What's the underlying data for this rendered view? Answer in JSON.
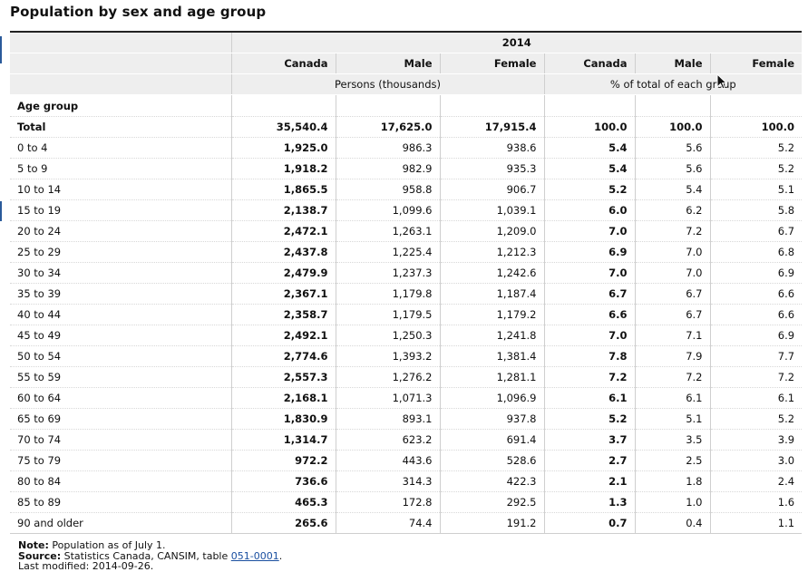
{
  "page": {
    "title": "Population by sex and age group"
  },
  "table": {
    "year": "2014",
    "columns": [
      "Canada",
      "Male",
      "Female",
      "Canada",
      "Male",
      "Female"
    ],
    "unit_groups": [
      "Persons (thousands)",
      "% of total of each group"
    ],
    "row_header_label": "Age group",
    "rows": [
      {
        "label": "Total",
        "values": [
          "35,540.4",
          "17,625.0",
          "17,915.4",
          "100.0",
          "100.0",
          "100.0"
        ]
      },
      {
        "label": "0 to 4",
        "values": [
          "1,925.0",
          "986.3",
          "938.6",
          "5.4",
          "5.6",
          "5.2"
        ]
      },
      {
        "label": "5 to 9",
        "values": [
          "1,918.2",
          "982.9",
          "935.3",
          "5.4",
          "5.6",
          "5.2"
        ]
      },
      {
        "label": "10 to 14",
        "values": [
          "1,865.5",
          "958.8",
          "906.7",
          "5.2",
          "5.4",
          "5.1"
        ]
      },
      {
        "label": "15 to 19",
        "values": [
          "2,138.7",
          "1,099.6",
          "1,039.1",
          "6.0",
          "6.2",
          "5.8"
        ]
      },
      {
        "label": "20 to 24",
        "values": [
          "2,472.1",
          "1,263.1",
          "1,209.0",
          "7.0",
          "7.2",
          "6.7"
        ]
      },
      {
        "label": "25 to 29",
        "values": [
          "2,437.8",
          "1,225.4",
          "1,212.3",
          "6.9",
          "7.0",
          "6.8"
        ]
      },
      {
        "label": "30 to 34",
        "values": [
          "2,479.9",
          "1,237.3",
          "1,242.6",
          "7.0",
          "7.0",
          "6.9"
        ]
      },
      {
        "label": "35 to 39",
        "values": [
          "2,367.1",
          "1,179.8",
          "1,187.4",
          "6.7",
          "6.7",
          "6.6"
        ]
      },
      {
        "label": "40 to 44",
        "values": [
          "2,358.7",
          "1,179.5",
          "1,179.2",
          "6.6",
          "6.7",
          "6.6"
        ]
      },
      {
        "label": "45 to 49",
        "values": [
          "2,492.1",
          "1,250.3",
          "1,241.8",
          "7.0",
          "7.1",
          "6.9"
        ]
      },
      {
        "label": "50 to 54",
        "values": [
          "2,774.6",
          "1,393.2",
          "1,381.4",
          "7.8",
          "7.9",
          "7.7"
        ]
      },
      {
        "label": "55 to 59",
        "values": [
          "2,557.3",
          "1,276.2",
          "1,281.1",
          "7.2",
          "7.2",
          "7.2"
        ]
      },
      {
        "label": "60 to 64",
        "values": [
          "2,168.1",
          "1,071.3",
          "1,096.9",
          "6.1",
          "6.1",
          "6.1"
        ]
      },
      {
        "label": "65 to 69",
        "values": [
          "1,830.9",
          "893.1",
          "937.8",
          "5.2",
          "5.1",
          "5.2"
        ]
      },
      {
        "label": "70 to 74",
        "values": [
          "1,314.7",
          "623.2",
          "691.4",
          "3.7",
          "3.5",
          "3.9"
        ]
      },
      {
        "label": "75 to 79",
        "values": [
          "972.2",
          "443.6",
          "528.6",
          "2.7",
          "2.5",
          "3.0"
        ]
      },
      {
        "label": "80 to 84",
        "values": [
          "736.6",
          "314.3",
          "422.3",
          "2.1",
          "1.8",
          "2.4"
        ]
      },
      {
        "label": "85 to 89",
        "values": [
          "465.3",
          "172.8",
          "292.5",
          "1.3",
          "1.0",
          "1.6"
        ]
      },
      {
        "label": "90 and older",
        "values": [
          "265.6",
          "74.4",
          "191.2",
          "0.7",
          "0.4",
          "1.1"
        ]
      }
    ]
  },
  "notes": {
    "note_label": "Note:",
    "note_text": "Population as of July 1.",
    "source_label": "Source:",
    "source_text": "Statistics Canada, CANSIM, table",
    "source_link": "051-0001",
    "source_end": ".",
    "modified_text": "Last modified: 2014-09-26."
  },
  "colors": {
    "header_bg": "#eeeeee",
    "link": "#1a4fa0",
    "left_marks": "#2a5a9a"
  },
  "icons": {
    "cursor": "mouse-pointer-icon"
  }
}
